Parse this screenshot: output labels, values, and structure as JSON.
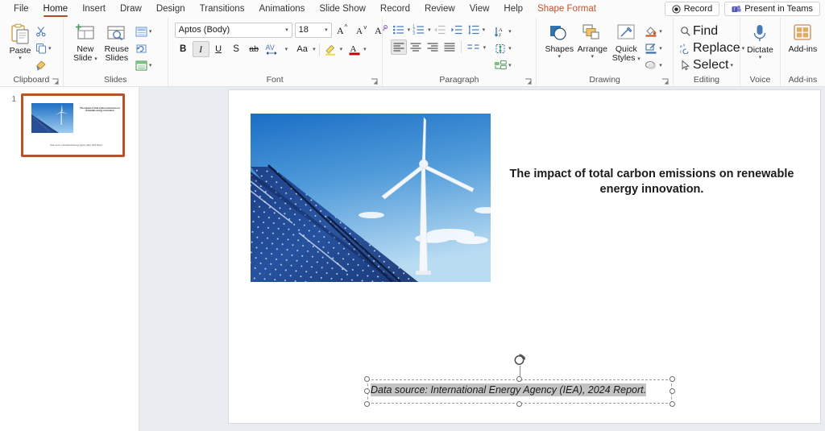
{
  "tabs": [
    {
      "label": "File",
      "state": "normal"
    },
    {
      "label": "Home",
      "state": "active"
    },
    {
      "label": "Insert",
      "state": "normal"
    },
    {
      "label": "Draw",
      "state": "normal"
    },
    {
      "label": "Design",
      "state": "normal"
    },
    {
      "label": "Transitions",
      "state": "normal"
    },
    {
      "label": "Animations",
      "state": "normal"
    },
    {
      "label": "Slide Show",
      "state": "normal"
    },
    {
      "label": "Record",
      "state": "normal"
    },
    {
      "label": "Review",
      "state": "normal"
    },
    {
      "label": "View",
      "state": "normal"
    },
    {
      "label": "Help",
      "state": "normal"
    },
    {
      "label": "Shape Format",
      "state": "contextual"
    }
  ],
  "titlebar_buttons": {
    "record": {
      "label": "Record",
      "icon": "record-circle-icon"
    },
    "present_in_teams": {
      "label": "Present in Teams",
      "icon": "teams-icon"
    }
  },
  "ribbon": {
    "clipboard": {
      "label": "Clipboard",
      "paste": "Paste",
      "cut_icon": "scissors-icon",
      "copy_icon": "copy-icon",
      "format_painter_icon": "format-painter-icon",
      "dialog_launcher": "⤵"
    },
    "slides": {
      "label": "Slides",
      "new_slide": "New\nSlide",
      "new_slide_line1": "New",
      "new_slide_line2": "Slide",
      "reuse_slides_line1": "Reuse",
      "reuse_slides_line2": "Slides",
      "layout_icon": "slide-layout-icon",
      "reset_icon": "slide-reset-icon",
      "section_icon": "slide-section-icon"
    },
    "font": {
      "label": "Font",
      "font_name": "Aptos (Body)",
      "font_size": "18",
      "grow_font_icon": "grow-font-icon",
      "shrink_font_icon": "shrink-font-icon",
      "clear_formatting_icon": "clear-formatting-icon",
      "bold": "B",
      "italic": "I",
      "underline": "U",
      "shadow": "S",
      "strikethrough": "ab",
      "character_spacing": "AV",
      "change_case": "Aa",
      "highlight_icon": "text-highlight-icon",
      "font_color": "A",
      "dialog_launcher": "⤵",
      "italic_active": true
    },
    "paragraph": {
      "label": "Paragraph",
      "bullets_icon": "bullets-icon",
      "numbering_icon": "numbering-icon",
      "decrease_indent_icon": "decrease-indent-icon",
      "increase_indent_icon": "increase-indent-icon",
      "line_spacing_icon": "line-spacing-icon",
      "text_direction_icon": "text-direction-icon",
      "align_text_icon": "align-text-icon",
      "convert_smartart_icon": "smartart-icon",
      "align_left_icon": "align-left-icon",
      "align_center_icon": "align-center-icon",
      "align_right_icon": "align-right-icon",
      "justify_icon": "justify-icon",
      "columns_icon": "columns-icon",
      "dialog_launcher": "⤵",
      "align_left_active": true
    },
    "drawing": {
      "label": "Drawing",
      "shapes": "Shapes",
      "arrange": "Arrange",
      "quick_styles_line1": "Quick",
      "quick_styles_line2": "Styles",
      "shape_fill_icon": "shape-fill-icon",
      "shape_outline_icon": "shape-outline-icon",
      "shape_effects_icon": "shape-effects-icon",
      "dialog_launcher": "⤵"
    },
    "editing": {
      "label": "Editing",
      "find": "Find",
      "replace": "Replace",
      "select": "Select",
      "find_icon": "search-icon",
      "replace_icon": "replace-icon",
      "select_icon": "cursor-select-icon"
    },
    "voice": {
      "label": "Voice",
      "dictate": "Dictate",
      "dictate_icon": "microphone-icon"
    },
    "addins": {
      "label": "Add-ins",
      "addins": "Add-ins",
      "addins_icon": "addins-grid-icon"
    }
  },
  "slide_panel": {
    "slides": [
      {
        "number": "1",
        "title": "The impact of total carbon emissions on renewable energy innovation.",
        "source": "Data source: International Energy Agency (IEA), 2024 Report.",
        "selected": true
      }
    ],
    "selection_color": "#b5532c"
  },
  "slide": {
    "title": "The impact of total carbon emissions on renewable energy innovation.",
    "image_alt": "solar-panels-and-wind-turbine-photo",
    "text_box": {
      "text": "Data source: International Energy Agency (IEA), 2024 Report.",
      "selected": true,
      "italic": true,
      "highlight_color": "#c4c4c4",
      "handles": 8,
      "rotation_handle_icon": "rotate-icon"
    }
  },
  "colors": {
    "accent": "#b5532c",
    "contextual_tab": "#c2522b",
    "workspace_bg": "#e9ecf0",
    "ribbon_bg": "#fbfbfb"
  }
}
